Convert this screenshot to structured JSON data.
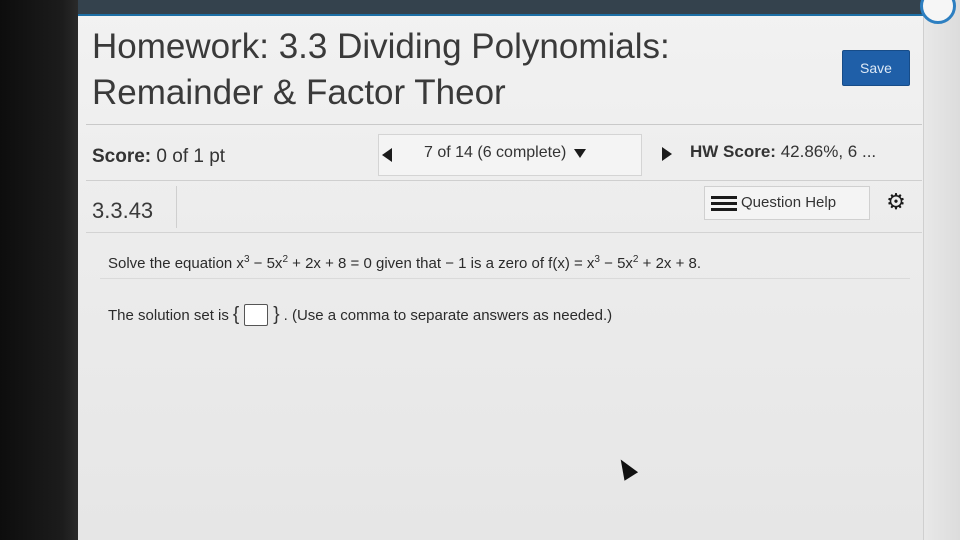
{
  "page": {
    "title_line1": "Homework: 3.3 Dividing Polynomials:",
    "title_line2": "Remainder & Factor Theor",
    "save_label": "Save"
  },
  "score_row": {
    "score_label": "Score:",
    "score_value": "0 of 1 pt",
    "question_nav": "7 of 14 (6 complete)",
    "hw_score_label": "HW Score:",
    "hw_score_value": "42.86%, 6 ..."
  },
  "question_bar": {
    "number": "3.3.43",
    "help_label": "Question Help",
    "help_icon": "list-icon",
    "settings_icon": "gear-icon"
  },
  "question": {
    "prefix": "Solve the equation x",
    "sup1": "3",
    "part2": " − 5x",
    "sup2": "2",
    "part3": " + 2x + 8 = 0 given that  − 1 is a zero of f(x) = x",
    "sup3": "3",
    "part4": " − 5x",
    "sup4": "2",
    "part5": " + 2x + 8."
  },
  "answer": {
    "prefix": "The solution set is",
    "open_brace": "{",
    "close_brace": "}",
    "value": "",
    "hint": ". (Use a comma to separate answers as needed.)"
  },
  "colors": {
    "top_bar": "#34424d",
    "save_button": "#1f5fa8",
    "accent": "#2d7fc1"
  }
}
